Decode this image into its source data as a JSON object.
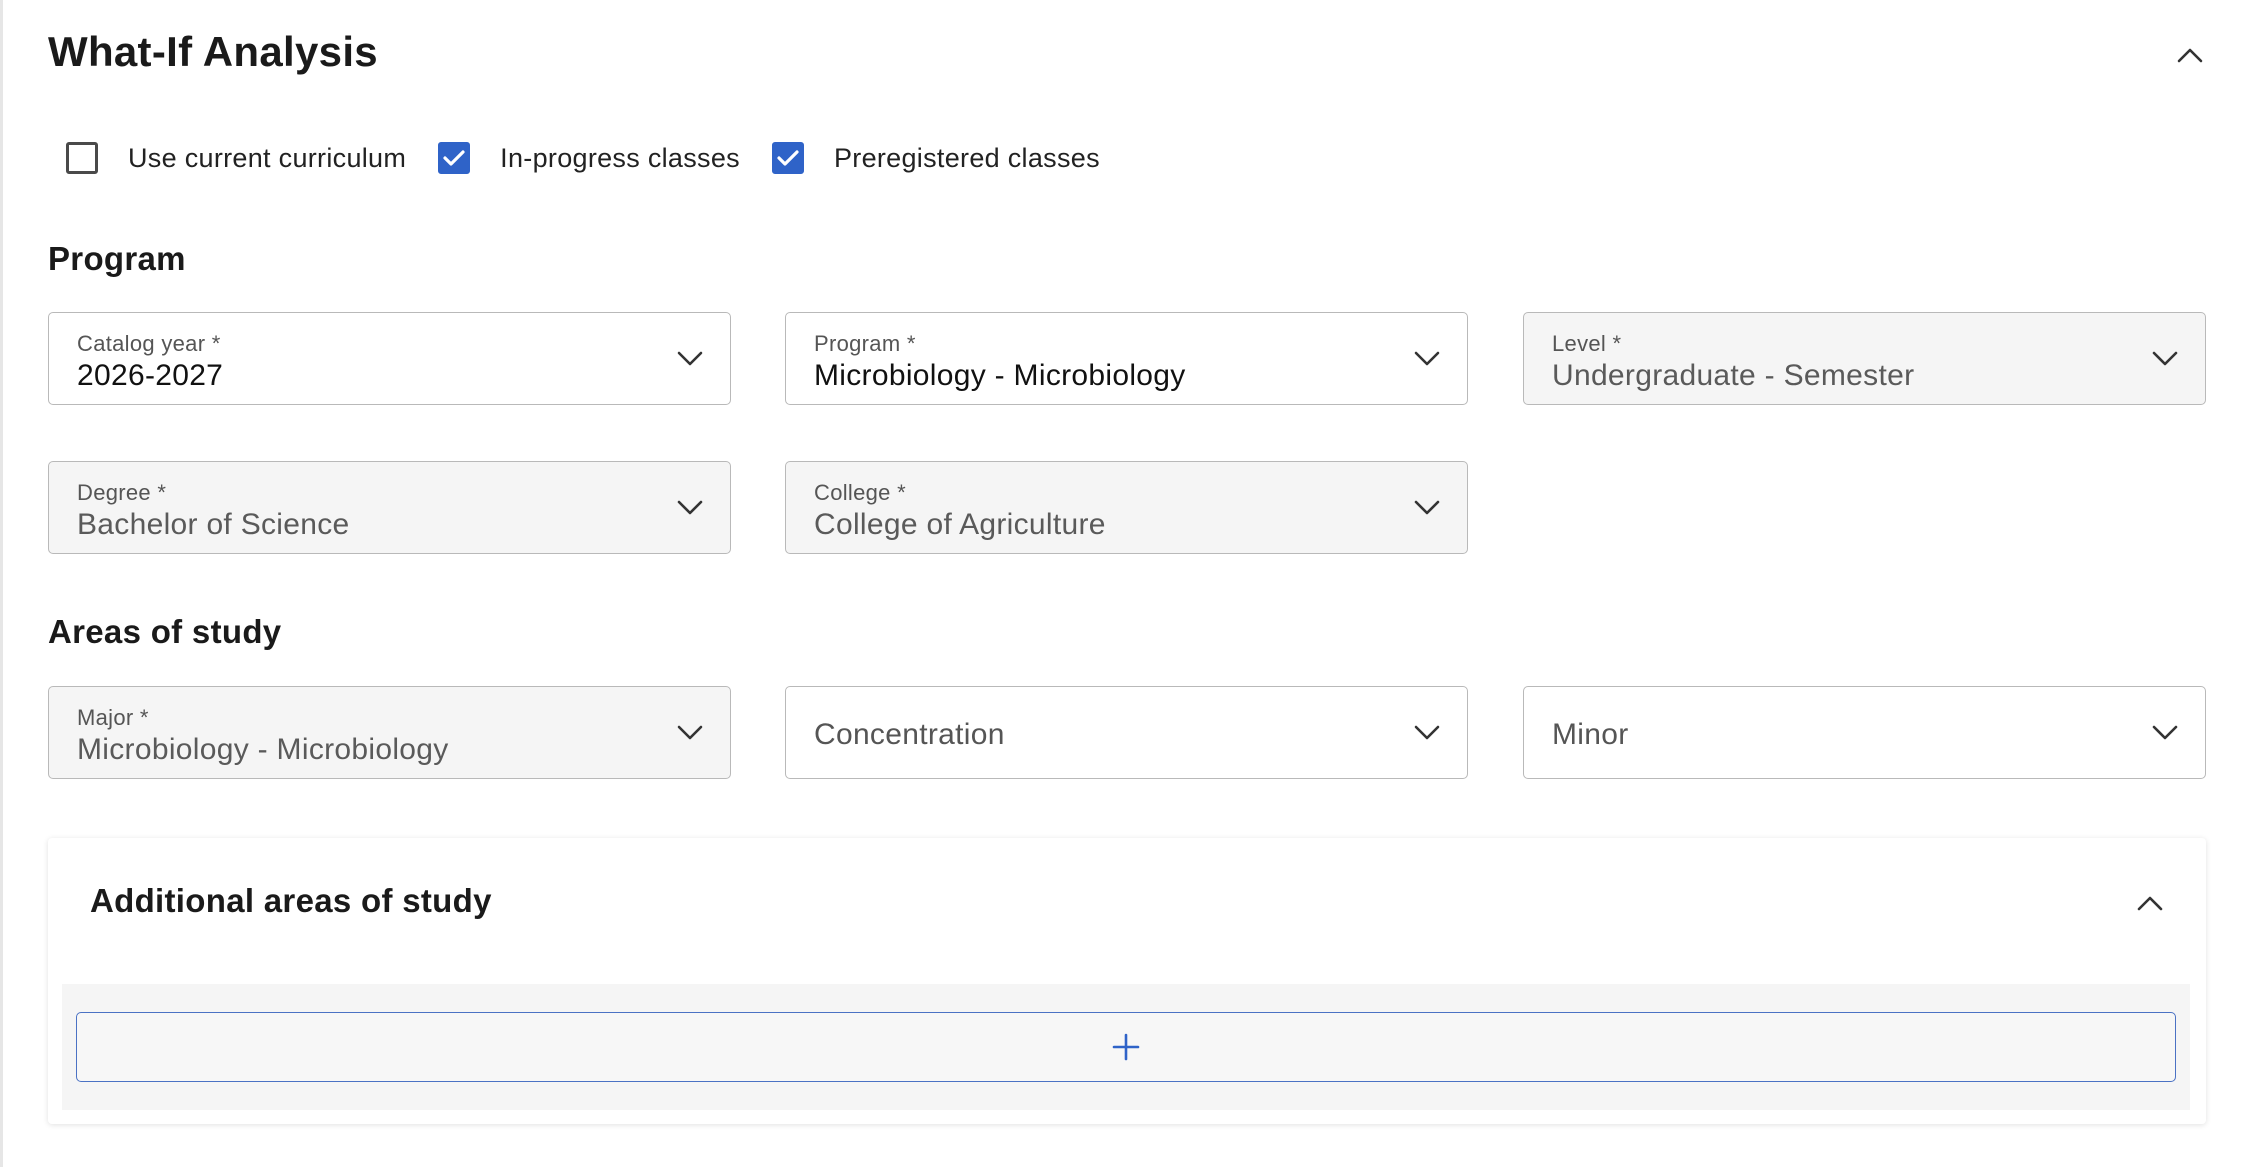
{
  "page": {
    "title": "What-If Analysis"
  },
  "options": [
    {
      "label": "Use current curriculum",
      "checked": false
    },
    {
      "label": "In-progress classes",
      "checked": true
    },
    {
      "label": "Preregistered classes",
      "checked": true
    }
  ],
  "program_section": {
    "heading": "Program",
    "catalog_year": {
      "label": "Catalog year *",
      "value": "2026-2027"
    },
    "program": {
      "label": "Program *",
      "value": "Microbiology - Microbiology"
    },
    "level": {
      "label": "Level *",
      "value": "Undergraduate - Semester"
    },
    "degree": {
      "label": "Degree *",
      "value": "Bachelor of Science"
    },
    "college": {
      "label": "College *",
      "value": "College of Agriculture"
    }
  },
  "areas_section": {
    "heading": "Areas of study",
    "major": {
      "label": "Major *",
      "value": "Microbiology - Microbiology"
    },
    "concentration": {
      "placeholder": "Concentration"
    },
    "minor": {
      "placeholder": "Minor"
    }
  },
  "additional": {
    "title": "Additional areas of study",
    "add_icon": "plus-icon"
  },
  "colors": {
    "accent": "#2f63c8",
    "disabled_field_bg": "#f5f5f5",
    "border": "#b9b9b9"
  }
}
